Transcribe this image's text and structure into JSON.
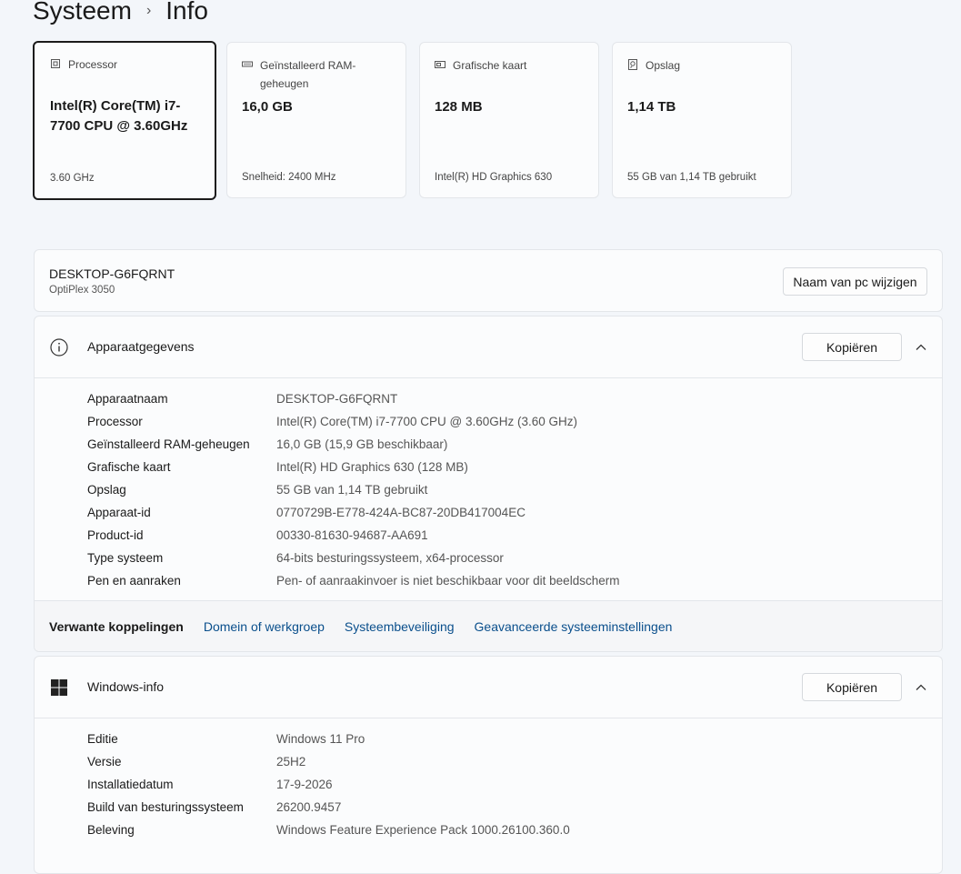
{
  "breadcrumb": {
    "parent": "Systeem",
    "separator": "›",
    "current": "Info"
  },
  "cards": [
    {
      "label": "Processor",
      "value": "Intel(R) Core(TM) i7-7700 CPU @ 3.60GHz",
      "sub": "3.60 GHz",
      "icon": "processor-icon"
    },
    {
      "label": "Geïnstalleerd RAM-geheugen",
      "value": "16,0 GB",
      "sub": "Snelheid: 2400 MHz",
      "icon": "ram-icon"
    },
    {
      "label": "Grafische kaart",
      "value": "128 MB",
      "sub": "Intel(R) HD Graphics 630",
      "icon": "graphics-card-icon"
    },
    {
      "label": "Opslag",
      "value": "1,14 TB",
      "sub": "55 GB van 1,14 TB gebruikt",
      "icon": "storage-icon"
    }
  ],
  "pc": {
    "name": "DESKTOP-G6FQRNT",
    "model": "OptiPlex 3050",
    "rename_label": "Naam van pc wijzigen"
  },
  "device_specs": {
    "title": "Apparaatgegevens",
    "copy_label": "Kopiëren",
    "rows": [
      {
        "key": "Apparaatnaam",
        "value": "DESKTOP-G6FQRNT"
      },
      {
        "key": "Processor",
        "value": "Intel(R) Core(TM) i7-7700 CPU @ 3.60GHz (3.60 GHz)"
      },
      {
        "key": "Geïnstalleerd RAM-geheugen",
        "value": "16,0 GB (15,9 GB beschikbaar)"
      },
      {
        "key": "Grafische kaart",
        "value": "Intel(R) HD Graphics 630 (128 MB)"
      },
      {
        "key": "Opslag",
        "value": "55 GB van 1,14 TB gebruikt"
      },
      {
        "key": "Apparaat-id",
        "value": "0770729B-E778-424A-BC87-20DB417004EC"
      },
      {
        "key": "Product-id",
        "value": "00330-81630-94687-AA691"
      },
      {
        "key": "Type systeem",
        "value": "64-bits besturingssysteem, x64-processor"
      },
      {
        "key": "Pen en aanraken",
        "value": "Pen- of aanraakinvoer is niet beschikbaar voor dit beeldscherm"
      }
    ]
  },
  "related": {
    "label": "Verwante koppelingen",
    "links": [
      "Domein of werkgroep",
      "Systeembeveiliging",
      "Geavanceerde systeeminstellingen"
    ]
  },
  "windows_specs": {
    "title": "Windows-info",
    "copy_label": "Kopiëren",
    "rows": [
      {
        "key": "Editie",
        "value": "Windows 11 Pro"
      },
      {
        "key": "Versie",
        "value": "25H2"
      },
      {
        "key": "Installatiedatum",
        "value": "17-9-2026"
      },
      {
        "key": "Build van besturingssysteem",
        "value": "26200.9457"
      },
      {
        "key": "Beleving",
        "value": "Windows Feature Experience Pack 1000.26100.360.0"
      }
    ]
  },
  "colors": {
    "link": "#0a4f8c",
    "background": "#f3f6fa",
    "card": "#fbfcfd"
  }
}
